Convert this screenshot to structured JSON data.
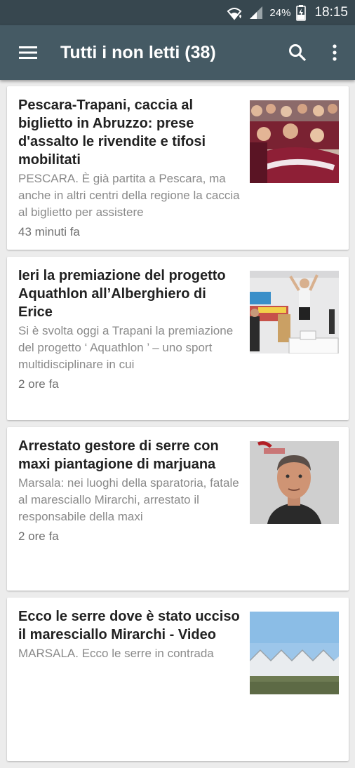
{
  "status_bar": {
    "battery_percent": "24%",
    "time": "18:15",
    "icons": [
      "wifi-icon",
      "signal-icon",
      "battery-charging-icon"
    ]
  },
  "app_bar": {
    "title": "Tutti i non letti (38)",
    "icons": [
      "menu-icon",
      "search-icon",
      "more-vert-icon"
    ]
  },
  "articles": [
    {
      "title": "Pescara-Trapani, caccia al biglietto in Abruzzo: prese d'assalto le rivendite e tifosi mobilitati",
      "snippet": "PESCARA.  È già partita a Pescara, ma anche in altri centri della regione la caccia al biglietto per assistere",
      "time": "43 minuti fa",
      "image": "football-fans-photo"
    },
    {
      "title": "Ieri la premiazione del progetto Aquathlon all’Alberghiero di Erice",
      "snippet": "Si è svolta oggi a Trapani la premiazione del progetto ‘ Aquathlon ’ – uno sport multidisciplinare in cui",
      "time": "2 ore fa",
      "image": "award-podium-photo"
    },
    {
      "title": "Arrestato gestore di serre con maxi piantagione di marjuana",
      "snippet": "Marsala: nei luoghi della sparatoria, fatale al maresciallo Mirarchi, arrestato il responsabile della maxi",
      "time": "2 ore fa",
      "image": "mugshot-photo"
    },
    {
      "title": "Ecco le serre dove è stato ucciso il maresciallo Mirarchi - Video",
      "snippet": "MARSALA. Ecco le serre in contrada",
      "time": "",
      "image": "greenhouses-photo"
    }
  ]
}
